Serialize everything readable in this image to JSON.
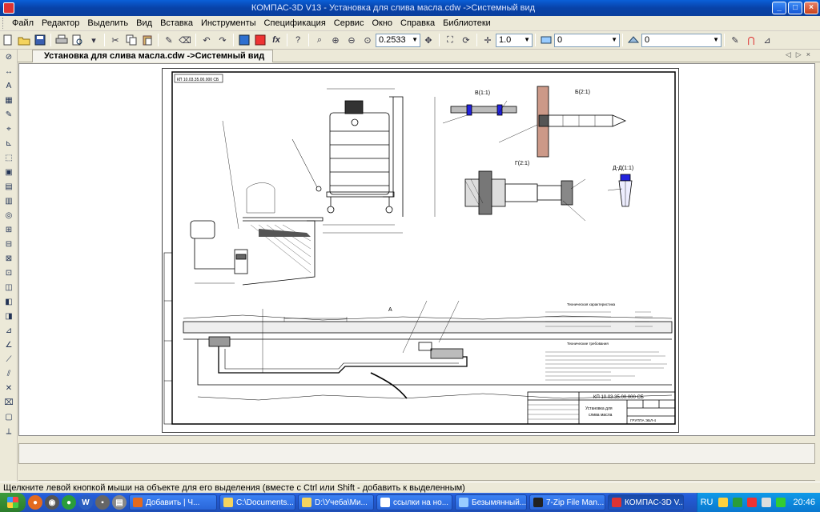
{
  "window": {
    "title": "КОМПАС-3D V13 - Установка для слива масла.cdw ->Системный вид"
  },
  "menu": [
    "Файл",
    "Редактор",
    "Выделить",
    "Вид",
    "Вставка",
    "Инструменты",
    "Спецификация",
    "Сервис",
    "Окно",
    "Справка",
    "Библиотеки"
  ],
  "toolbar": {
    "zoom": "0.2533",
    "step": "1.0",
    "layer": "0",
    "style": "0"
  },
  "document": {
    "tab_label": "Установка для слива масла.cdw ->Системный вид"
  },
  "drawing": {
    "designation_top": "КП 10.03.35.00.000 СБ",
    "view_b": "В(1:1)",
    "view_bb": "Б(2:1)",
    "view_g": "Г(2:1)",
    "view_dd": "Д-Д(1:1)",
    "view_a": "А",
    "tech_char_title": "Техническая характеристика",
    "tech_req_title": "Технические требования",
    "stamp_designation": "КП 10.03.35.00.000 СБ",
    "stamp_name_1": "Установка для",
    "stamp_name_2": "слива масла",
    "stamp_org": "ГРУППА ЭБЛ-4"
  },
  "status": {
    "text": "Щелкните левой кнопкой мыши на объекте для его выделения (вместе с Ctrl или Shift - добавить к выделенным)"
  },
  "taskbar": {
    "tasks": [
      "Добавить | Ч...",
      "C:\\Documents...",
      "D:\\Учеба\\Ми...",
      "ссылки на но...",
      "Безымянный...",
      "7-Zip File Man...",
      "КОМПАС-3D V..."
    ],
    "lang": "RU",
    "clock": "20:46"
  }
}
